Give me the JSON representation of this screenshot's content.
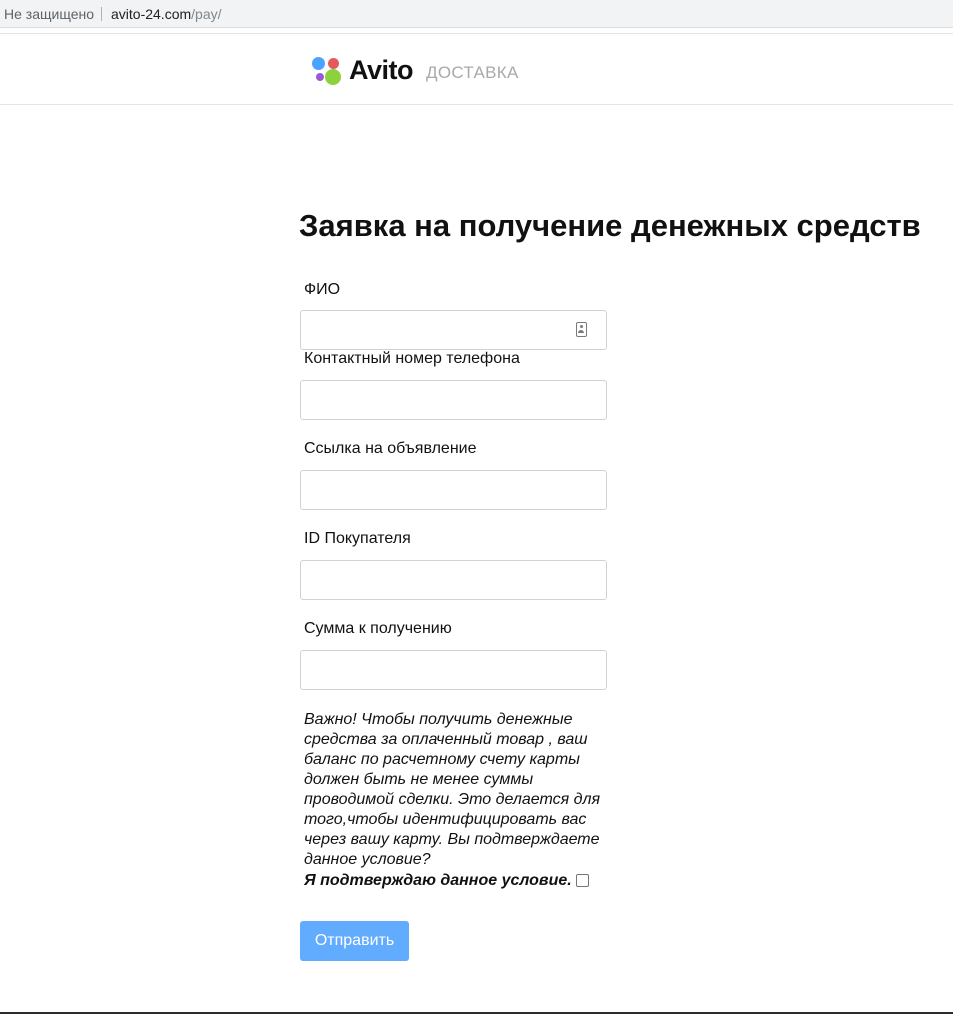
{
  "browser": {
    "security_label": "Не защищено",
    "url_host": "avito-24.com",
    "url_path": "/pay/"
  },
  "header": {
    "brand": "Avito",
    "brand_sub": "ДОСТАВКА",
    "logo_colors": [
      "#4aa3ff",
      "#e35b5b",
      "#9b59d6",
      "#8cd23c"
    ]
  },
  "form": {
    "title": "Заявка на получение денежных средств",
    "fields": [
      {
        "label": "ФИО",
        "value": ""
      },
      {
        "label": "Контактный номер телефона",
        "value": ""
      },
      {
        "label": "Ссылка на объявление",
        "value": ""
      },
      {
        "label": "ID Покупателя",
        "value": ""
      },
      {
        "label": "Сумма к получению",
        "value": ""
      }
    ],
    "notice": "Важно! Чтобы получить денежные средства за оплаченный товар , ваш баланс по расчетному счету карты должен быть не менее суммы проводимой сделки. Это делается для того,чтобы идентифицировать вас через вашу карту. Вы подтверждаете данное условие?",
    "confirm_label": "Я подтверждаю данное условие.",
    "confirm_checked": false,
    "submit_label": "Отправить",
    "submit_color": "#62acff"
  }
}
